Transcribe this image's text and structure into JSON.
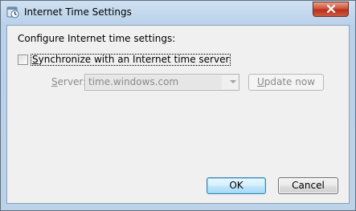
{
  "window": {
    "title": "Internet Time Settings",
    "close_icon": "close-icon",
    "title_icon": "clock-icon"
  },
  "content": {
    "heading": "Configure Internet time settings:",
    "sync_checkbox": {
      "label_hotkey": "S",
      "label_rest": "ynchronize with an Internet time server",
      "checked": false
    },
    "server": {
      "label_hotkey": "S",
      "label_rest": "erver:",
      "value": "time.windows.com",
      "enabled": false
    },
    "update_button": {
      "label_hotkey": "U",
      "label_rest": "pdate now",
      "enabled": false
    }
  },
  "footer": {
    "ok_label": "OK",
    "cancel_label": "Cancel"
  },
  "colors": {
    "accent": "#3c7fb1",
    "close_red": "#c7432b",
    "disabled_text": "#8a8a8a"
  }
}
